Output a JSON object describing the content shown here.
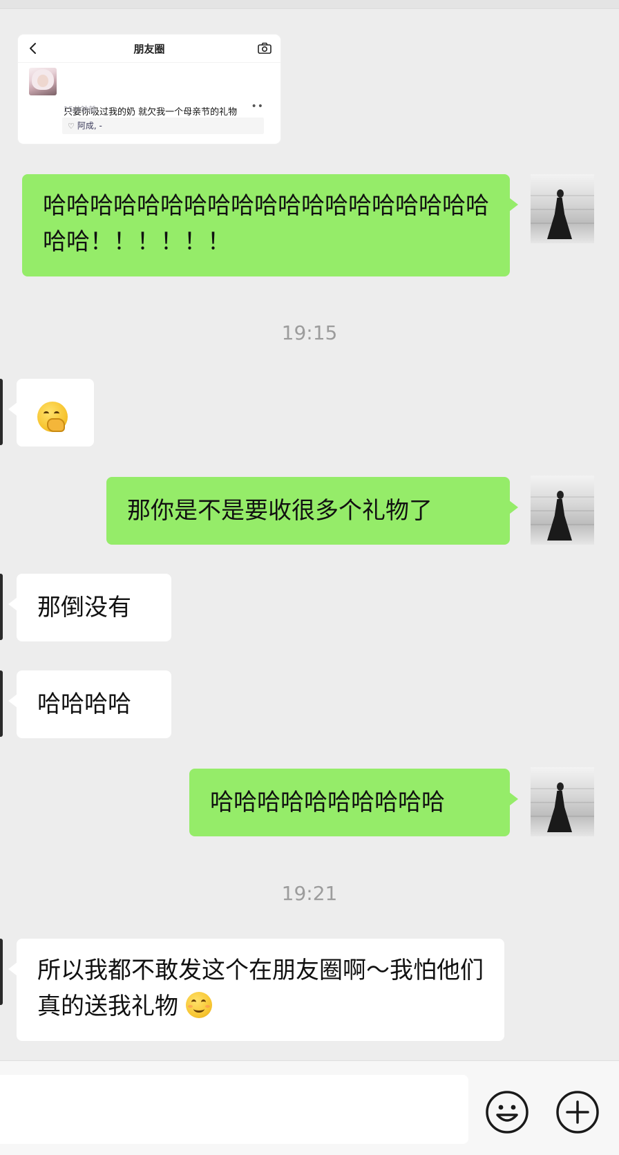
{
  "shared_moment": {
    "title": "朋友圈",
    "post_text": "只要你吸过我的奶 就欠我一个母亲节的礼物",
    "time": "15分钟前",
    "more": "••",
    "likes": "阿成, -"
  },
  "messages": [
    {
      "side": "self",
      "text": "哈哈哈哈哈哈哈哈哈哈哈哈哈哈哈哈哈哈哈哈哈！！！！！！"
    },
    {
      "type": "time",
      "text": "19:15"
    },
    {
      "side": "other",
      "emoji": "hand-over-mouth-emoji"
    },
    {
      "side": "self",
      "text": "那你是不是要收很多个礼物了"
    },
    {
      "side": "other",
      "text": "那倒没有"
    },
    {
      "side": "other",
      "text": "哈哈哈哈"
    },
    {
      "side": "self",
      "text": "哈哈哈哈哈哈哈哈哈哈"
    },
    {
      "type": "time",
      "text": "19:21"
    },
    {
      "side": "other",
      "text": "所以我都不敢发这个在朋友圈啊～我怕他们真的送我礼物",
      "emoji": "smile-emoji"
    }
  ],
  "input": {
    "value": ""
  },
  "colors": {
    "background": "#ededed",
    "self_bubble": "#95ec69",
    "other_bubble": "#ffffff",
    "time_text": "#9c9c9c"
  },
  "icons": [
    "back-arrow-icon",
    "camera-icon",
    "heart-icon",
    "emoji-face-icon",
    "add-plus-icon"
  ]
}
